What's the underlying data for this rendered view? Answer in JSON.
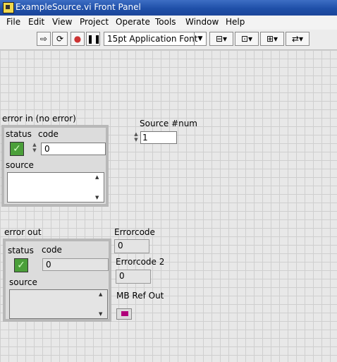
{
  "window": {
    "title": "ExampleSource.vi Front Panel"
  },
  "menu": [
    "File",
    "Edit",
    "View",
    "Project",
    "Operate",
    "Tools",
    "Window",
    "Help"
  ],
  "toolbar": {
    "font": "15pt Application Font"
  },
  "panel": {
    "error_in": {
      "label": "error in (no error)",
      "status_label": "status",
      "code_label": "code",
      "code_value": "0",
      "source_label": "source",
      "source_value": ""
    },
    "source_num": {
      "label": "Source #num",
      "value": "1"
    },
    "error_out": {
      "label": "error out",
      "status_label": "status",
      "code_label": "code",
      "code_value": "0",
      "source_label": "source",
      "source_value": ""
    },
    "errorcode": {
      "label": "Errorcode",
      "value": "0"
    },
    "errorcode2": {
      "label": "Errorcode 2",
      "value": "0"
    },
    "mb_ref_out": {
      "label": "MB Ref Out"
    }
  }
}
